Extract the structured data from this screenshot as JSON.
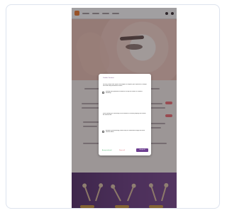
{
  "modal": {
    "title": "Cookie Consent",
    "paragraph_1": "We use cookies and similar technologies to improve your experience, analyze site traffic and personalize content.",
    "paragraph_2": "Manage your preferences below or accept all cookies to continue browsing.",
    "paragraph_3": "Some cookies are necessary for the website to function properly and cannot be switched off.",
    "paragraph_4": "Analytics and marketing cookies help us understand usage and show relevant offers.",
    "link_primary": "Accept selected",
    "link_secondary": "Reject all",
    "button_label": "Accept all"
  },
  "colors": {
    "brand_orange": "#f07d31",
    "modal_purple": "#6e3f91",
    "accent_green": "#2ca354",
    "accent_red": "#d45f69"
  },
  "icons": {
    "logo": "brand-logo-icon",
    "account": "user-icon",
    "cart": "cart-icon"
  }
}
